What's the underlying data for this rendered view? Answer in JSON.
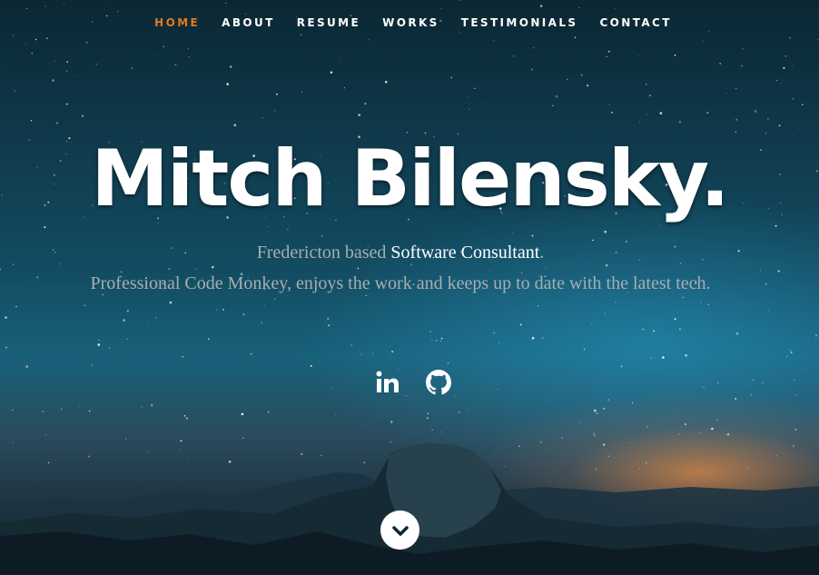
{
  "nav": {
    "items": [
      {
        "label": "HOME",
        "active": true
      },
      {
        "label": "ABOUT",
        "active": false
      },
      {
        "label": "RESUME",
        "active": false
      },
      {
        "label": "WORKS",
        "active": false
      },
      {
        "label": "TESTIMONIALS",
        "active": false
      },
      {
        "label": "CONTACT",
        "active": false
      }
    ]
  },
  "hero": {
    "title": "Mitch Bilensky.",
    "intro_prefix": "Fredericton based ",
    "intro_highlight": "Software Consultant",
    "intro_suffix": ".",
    "description": "Professional Code Monkey, enjoys the work and keeps up to date with the latest tech."
  },
  "social": {
    "items": [
      {
        "icon": "linkedin-icon"
      },
      {
        "icon": "github-icon"
      }
    ]
  },
  "scroll": {
    "icon": "chevron-down-icon"
  },
  "colors": {
    "accent": "#e07b1f",
    "text": "#ffffff",
    "muted_text": "#a7aeb0"
  }
}
